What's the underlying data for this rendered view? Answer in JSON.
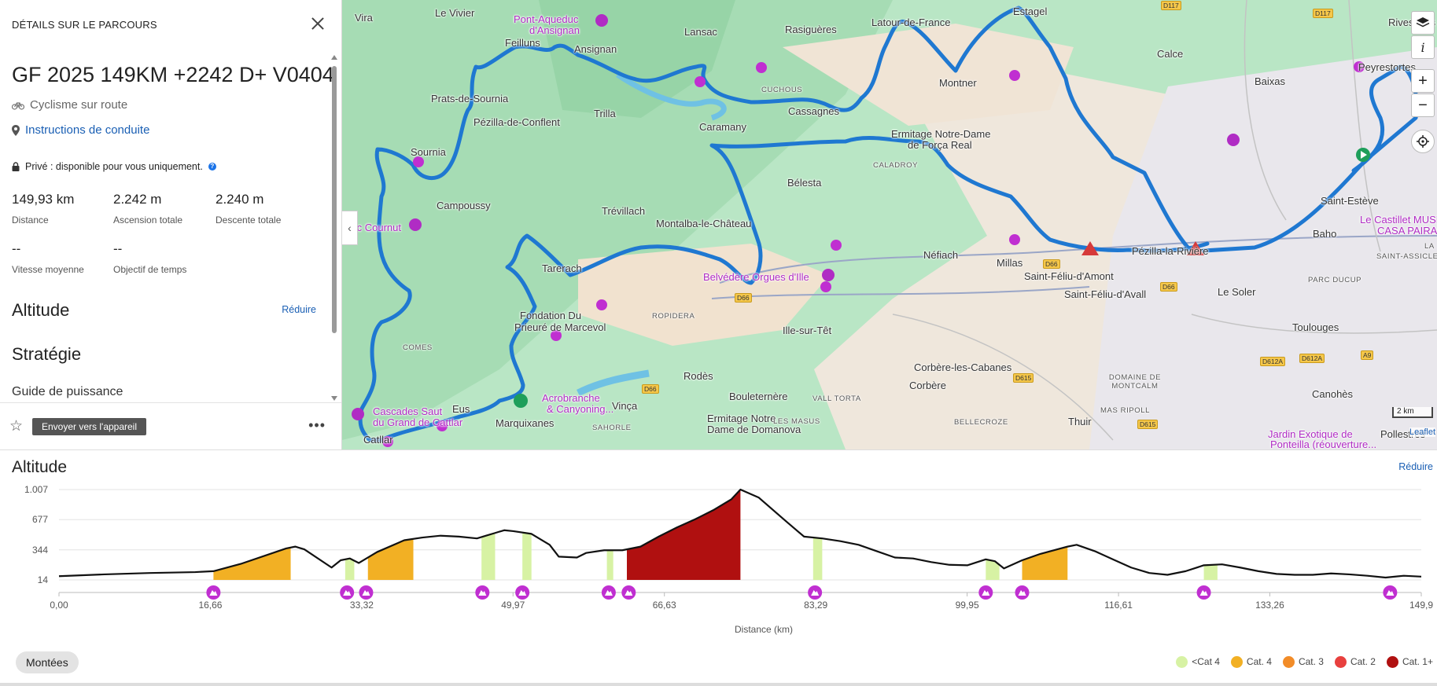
{
  "panel": {
    "header": "DÉTAILS SUR LE PARCOURS",
    "route_name": "GF 2025 149KM +2242 D+ V0404",
    "sport": "Cyclisme sur route",
    "directions": "Instructions de conduite",
    "privacy": "Privé : disponible pour vous uniquement.",
    "info_glyph": "?",
    "stats": [
      {
        "value": "149,93 km",
        "label": "Distance"
      },
      {
        "value": "2.242 m",
        "label": "Ascension totale"
      },
      {
        "value": "2.240 m",
        "label": "Descente totale"
      },
      {
        "value": "--",
        "label": "Vitesse moyenne"
      },
      {
        "value": "--",
        "label": "Objectif de temps"
      }
    ],
    "altitude_heading": "Altitude",
    "collapse_label": "Réduire",
    "strategy_heading": "Stratégie",
    "power_guide": "Guide de puissance",
    "send_button": "Envoyer vers l'appareil",
    "more_glyph": "•••"
  },
  "map": {
    "labels": [
      "Vira",
      "Le Vivier",
      "Pont-Aqueduc",
      "d'Ansignan",
      "Feilluns",
      "Lansac",
      "Rasiguères",
      "Latour-de-France",
      "Estagel",
      "Rivesaltes",
      "Ansignan",
      "Calce",
      "Prats-de-Sournia",
      "Montner",
      "Pézilla-de-Conflent",
      "Trilla",
      "Caramany",
      "Cassagnes",
      "Baixas",
      "Peyrestortes",
      "Ermitage Notre-Dame",
      "de Força Real",
      "Sournia",
      "Bélesta",
      "Saint-Estève",
      "Campoussy",
      "Trévillach",
      "Montalba-le-Château",
      "Roc Cournut",
      "Le Castillet MUSÉE",
      "CASA PAIRAL",
      "Baho",
      "Néfiach",
      "Millas",
      "Pézilla-la-Rivière",
      "Tarerach",
      "Belvédère Orgues d'Ille",
      "Saint-Féliu-d'Amont",
      "Saint-Féliu-d'Avall",
      "Le Soler",
      "Fondation Du",
      "Prieuré de Marcevol",
      "Ille-sur-Têt",
      "Toulouges",
      "Rodès",
      "Corbère-les-Cabanes",
      "Corbère",
      "Cascades Saut",
      "du Grand de Cattlar",
      "Eus",
      "Acrobranche",
      "& Canyoning...",
      "Vinça",
      "Bouleternère",
      "Canohès",
      "Marquixanes",
      "Ermitage Notre",
      "Dame de Domanova",
      "Jardin Exotique de",
      "Ponteilla (réouverture...",
      "Thuir",
      "Pollestres",
      "Catllar"
    ],
    "small_labels": [
      "CUCHOUS",
      "CALADROY",
      "ROPIDERA",
      "COMES",
      "VALL TORTA",
      "LES MASUS",
      "BELLECROZE",
      "DOMAINE DE MONTCALM",
      "MAS RIPOLL",
      "PARC DUCUP",
      "SAINT-ASSICLE",
      "SAHORLE",
      "LA"
    ],
    "roads": [
      "D117",
      "D117",
      "D66",
      "D66",
      "D66",
      "D66",
      "D615",
      "D615",
      "D612A",
      "D612A",
      "A9"
    ],
    "scale": "2 km",
    "attribution": "Leaflet",
    "route_color": "#1f78d1",
    "poi_color": "#b02cc4"
  },
  "elevation": {
    "title": "Altitude",
    "collapse_label": "Réduire",
    "climbs_button": "Montées",
    "legend": [
      {
        "label": "<Cat 4",
        "color": "#d7f2a4"
      },
      {
        "label": "Cat. 4",
        "color": "#f2b024"
      },
      {
        "label": "Cat. 3",
        "color": "#f28c28"
      },
      {
        "label": "Cat. 2",
        "color": "#e8403e"
      },
      {
        "label": "Cat. 1+",
        "color": "#b01010"
      }
    ]
  },
  "chart_data": {
    "type": "area",
    "title": "Altitude",
    "xlabel": "Distance (km)",
    "ylabel": "",
    "xlim": [
      0,
      149.93
    ],
    "ylim": [
      14,
      1007
    ],
    "x_ticks": [
      "0,00",
      "16,66",
      "33,32",
      "49,97",
      "66,63",
      "83,29",
      "99,95",
      "116,61",
      "133,26",
      "149,9"
    ],
    "y_ticks": [
      "1.007",
      "677",
      "344",
      "14"
    ],
    "x": [
      0,
      5,
      10,
      15,
      17,
      20,
      25,
      26,
      27,
      30,
      31,
      32,
      33,
      35,
      38,
      40,
      42,
      44,
      46,
      47,
      48,
      49,
      50,
      52,
      54,
      55,
      57,
      58,
      60,
      62,
      64,
      66,
      68,
      70,
      72,
      74,
      75,
      77,
      80,
      82,
      84,
      86,
      88,
      90,
      92,
      94,
      96,
      98,
      100,
      102,
      103,
      104,
      106,
      108,
      111,
      112,
      114,
      116,
      118,
      120,
      122,
      124,
      126,
      128,
      130,
      132,
      134,
      136,
      138,
      140,
      142,
      144,
      146,
      148,
      149.93
    ],
    "values": [
      55,
      75,
      90,
      100,
      110,
      190,
      360,
      380,
      350,
      150,
      230,
      250,
      200,
      320,
      450,
      480,
      500,
      490,
      470,
      500,
      530,
      560,
      550,
      520,
      400,
      270,
      260,
      310,
      340,
      340,
      380,
      490,
      590,
      680,
      780,
      900,
      1007,
      920,
      660,
      490,
      470,
      440,
      400,
      330,
      260,
      250,
      210,
      180,
      175,
      240,
      220,
      140,
      230,
      300,
      380,
      400,
      330,
      240,
      150,
      90,
      70,
      110,
      175,
      185,
      150,
      110,
      80,
      70,
      70,
      85,
      75,
      60,
      40,
      60,
      50
    ],
    "climbs": [
      {
        "from": 17,
        "to": 25.5,
        "category": "Cat. 4"
      },
      {
        "from": 31.5,
        "to": 32.5,
        "category": "<Cat 4"
      },
      {
        "from": 34,
        "to": 39,
        "category": "Cat. 4"
      },
      {
        "from": 46.5,
        "to": 48,
        "category": "<Cat 4"
      },
      {
        "from": 51,
        "to": 52,
        "category": "<Cat 4"
      },
      {
        "from": 60.3,
        "to": 61,
        "category": "<Cat 4"
      },
      {
        "from": 62.5,
        "to": 75,
        "category": "Cat. 1+"
      },
      {
        "from": 83,
        "to": 84,
        "category": "<Cat 4"
      },
      {
        "from": 102,
        "to": 103.5,
        "category": "<Cat 4"
      },
      {
        "from": 106,
        "to": 111,
        "category": "Cat. 4"
      },
      {
        "from": 126,
        "to": 127.5,
        "category": "<Cat 4"
      }
    ],
    "markers_km": [
      17,
      31.7,
      33.8,
      46.6,
      51,
      60.5,
      62.7,
      83.2,
      102,
      106,
      126,
      146.5
    ]
  }
}
